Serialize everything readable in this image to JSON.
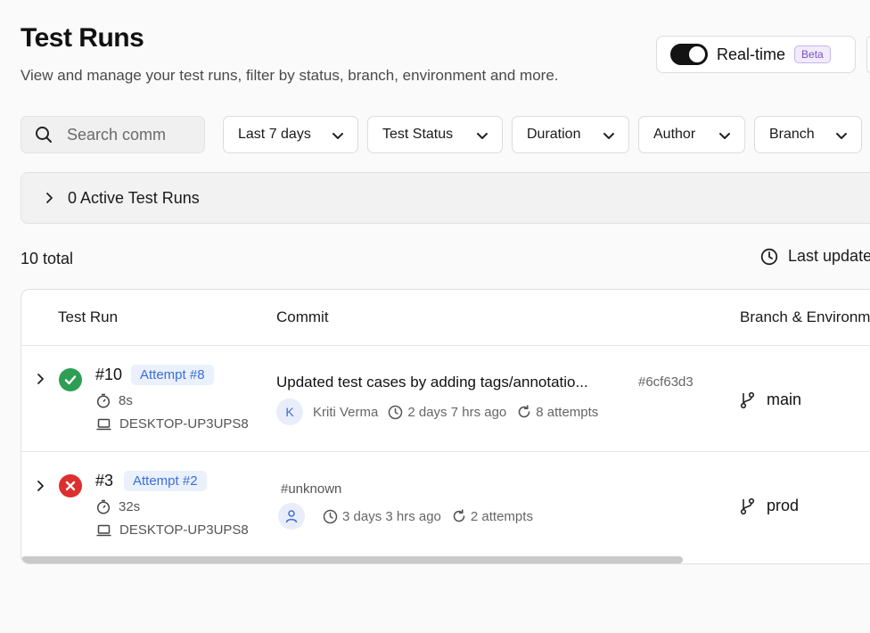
{
  "header": {
    "title": "Test Runs",
    "subtitle": "View and manage your test runs, filter by status, branch, environment and more."
  },
  "realtime": {
    "label": "Real-time",
    "badge": "Beta",
    "enabled": true
  },
  "filters": {
    "search_placeholder": "Search commits",
    "search_visible_text": "Search comı",
    "date_range": "Last 7 days",
    "test_status": "Test Status",
    "duration": "Duration",
    "author": "Author",
    "branch": "Branch"
  },
  "active_runs": {
    "label": "0 Active Test Runs"
  },
  "summary": {
    "total": "10 total",
    "last_updated": "Last updated"
  },
  "table": {
    "columns": [
      "Test Run",
      "Commit",
      "Branch & Environment"
    ],
    "rows": [
      {
        "status": "passed",
        "run_id": "#10",
        "attempt": "Attempt #8",
        "duration": "8s",
        "machine": "DESKTOP-UP3UPS8",
        "commit_title": "Updated test cases by adding tags/annotatio...",
        "commit_hash": "#6cf63d3",
        "author_initial": "K",
        "author": "Kriti Verma",
        "time": "2 days 7 hrs ago",
        "attempts": "8 attempts",
        "branch": "main"
      },
      {
        "status": "failed",
        "run_id": "#3",
        "attempt": "Attempt #2",
        "duration": "32s",
        "machine": "DESKTOP-UP3UPS8",
        "commit_title": "#unknown",
        "commit_hash": "",
        "author_initial": "",
        "author": "",
        "time": "3 days 3 hrs ago",
        "attempts": "2 attempts",
        "branch": "prod"
      }
    ]
  },
  "colors": {
    "pass": "#2e9e55",
    "fail": "#de2f2f",
    "accent": "#3a6fd8",
    "beta": "#7a4fc9"
  }
}
